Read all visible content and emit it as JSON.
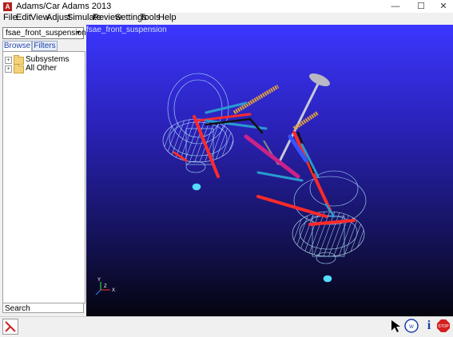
{
  "window": {
    "title": "Adams/Car Adams 2013",
    "app_icon_letter": "A",
    "min_glyph": "—",
    "max_glyph": "☐",
    "close_glyph": "✕"
  },
  "menu": {
    "items": [
      "File",
      "Edit",
      "View",
      "Adjust",
      "Simulate",
      "Review",
      "Settings",
      "Tools",
      "Help"
    ]
  },
  "left_panel": {
    "model_select_value": "fsae_front_suspension",
    "tabs": [
      "Browse",
      "Filters"
    ],
    "active_tab": "Browse",
    "tree": [
      "Subsystems",
      "All Other"
    ],
    "search_placeholder": "Search"
  },
  "viewport": {
    "model_name": "fsae_front_suspension",
    "background_top": "#3b36ff",
    "background_bottom": "#05050f",
    "triad_labels": {
      "x": "X",
      "y": "Y",
      "z": "Z"
    }
  },
  "statusbar": {
    "icons": [
      "pointer-icon",
      "wid-icon",
      "info-icon",
      "stop-icon"
    ],
    "info_glyph": "i",
    "stop_label": "STOP"
  }
}
